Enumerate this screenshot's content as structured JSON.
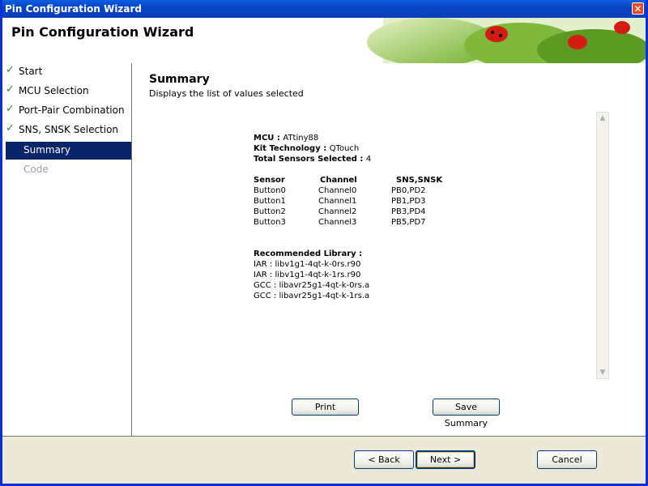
{
  "window": {
    "title": "Pin Configuration Wizard"
  },
  "header": {
    "title": "Pin Configuration Wizard"
  },
  "sidebar": {
    "items": [
      {
        "label": "Start",
        "state": "done"
      },
      {
        "label": "MCU Selection",
        "state": "done"
      },
      {
        "label": "Port-Pair Combination",
        "state": "done"
      },
      {
        "label": "SNS, SNSK Selection",
        "state": "done"
      },
      {
        "label": "Summary",
        "state": "active"
      },
      {
        "label": "Code",
        "state": "disabled"
      }
    ]
  },
  "content": {
    "title": "Summary",
    "subtitle": "Displays the list of values selected",
    "mcu_label": "MCU : ",
    "mcu_value": "ATtiny88",
    "kit_label": "Kit Technology : ",
    "kit_value": "QTouch",
    "sensors_label": "Total Sensors Selected : ",
    "sensors_value": "4",
    "table": {
      "headers": [
        "Sensor",
        "Channel",
        "SNS,SNSK"
      ],
      "rows": [
        [
          "Button0",
          "Channel0",
          "PB0,PD2"
        ],
        [
          "Button1",
          "Channel1",
          "PB1,PD3"
        ],
        [
          "Button2",
          "Channel2",
          "PB3,PD4"
        ],
        [
          "Button3",
          "Channel3",
          "PB5,PD7"
        ]
      ]
    },
    "library_label": "Recommended Library :",
    "libraries": [
      "IAR  : libv1g1-4qt-k-0rs.r90",
      "IAR  : libv1g1-4qt-k-1rs.r90",
      "GCC  : libavr25g1-4qt-k-0rs.a",
      "GCC  : libavr25g1-4qt-k-1rs.a"
    ],
    "print_label": "Print",
    "save_label": "Save Summary"
  },
  "footer": {
    "back_label": "< Back",
    "next_label": "Next >",
    "cancel_label": "Cancel"
  }
}
